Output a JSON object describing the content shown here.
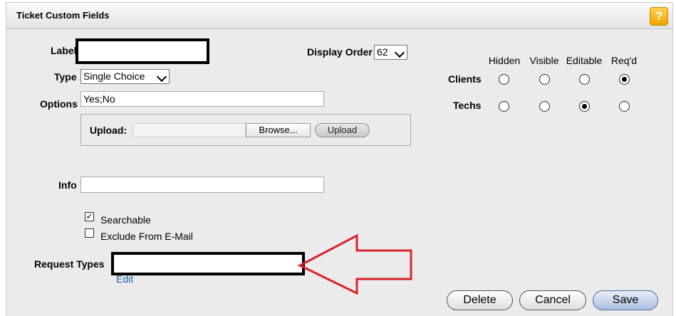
{
  "title": "Ticket Custom Fields",
  "help_icon": "?",
  "form": {
    "label_label": "Label",
    "display_order_label": "Display Order",
    "display_order_value": "62",
    "type_label": "Type",
    "type_value": "Single Choice",
    "options_label": "Options",
    "options_value": "Yes;No",
    "upload_label": "Upload:",
    "browse_label": "Browse...",
    "upload_button": "Upload",
    "info_label": "Info",
    "info_value": "",
    "searchable_label": "Searchable",
    "exclude_label": "Exclude From E-Mail",
    "request_types_label": "Request Types",
    "edit_link": "Edit"
  },
  "permissions": {
    "columns": [
      "Hidden",
      "Visible",
      "Editable",
      "Req'd"
    ],
    "rows": [
      {
        "label": "Clients",
        "selected": "Req'd"
      },
      {
        "label": "Techs",
        "selected": "Editable"
      }
    ]
  },
  "buttons": {
    "delete": "Delete",
    "cancel": "Cancel",
    "save": "Save"
  },
  "colors": {
    "annotation_arrow": "#d9232d",
    "link": "#1a5fa8"
  }
}
